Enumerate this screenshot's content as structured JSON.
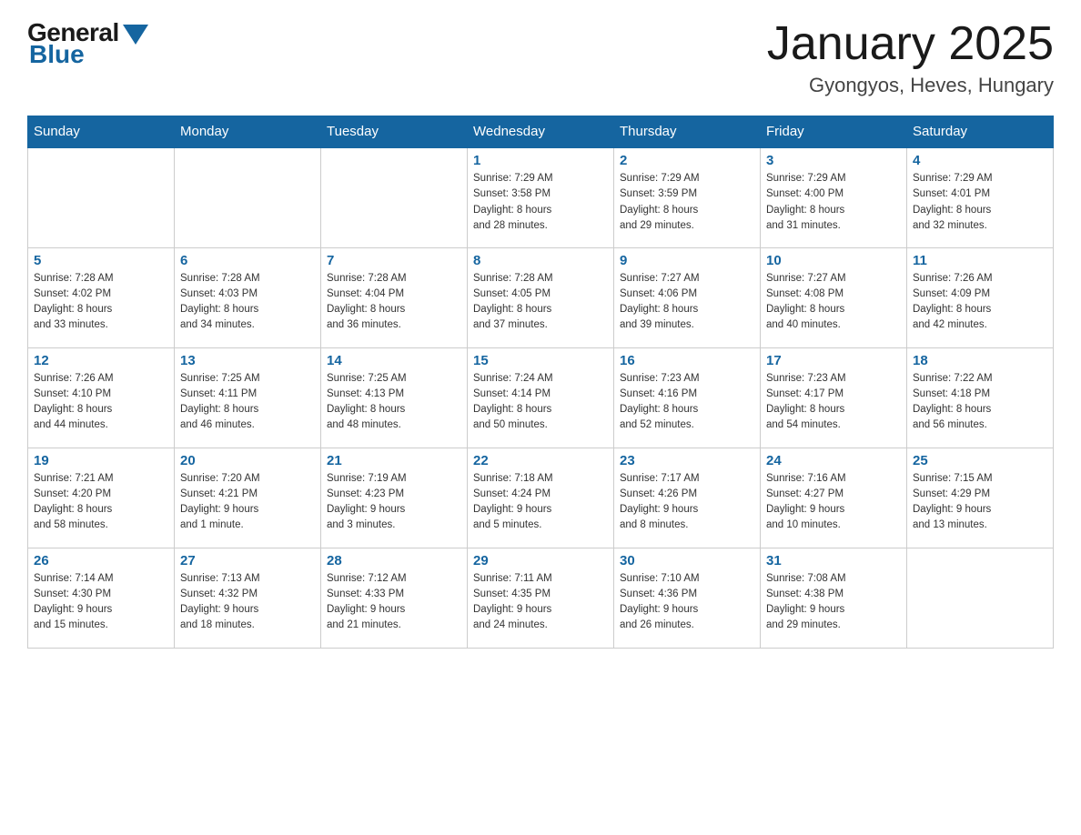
{
  "header": {
    "logo_general": "General",
    "logo_blue": "Blue",
    "title": "January 2025",
    "subtitle": "Gyongyos, Heves, Hungary"
  },
  "days_of_week": [
    "Sunday",
    "Monday",
    "Tuesday",
    "Wednesday",
    "Thursday",
    "Friday",
    "Saturday"
  ],
  "weeks": [
    [
      {
        "day": "",
        "info": ""
      },
      {
        "day": "",
        "info": ""
      },
      {
        "day": "",
        "info": ""
      },
      {
        "day": "1",
        "info": "Sunrise: 7:29 AM\nSunset: 3:58 PM\nDaylight: 8 hours\nand 28 minutes."
      },
      {
        "day": "2",
        "info": "Sunrise: 7:29 AM\nSunset: 3:59 PM\nDaylight: 8 hours\nand 29 minutes."
      },
      {
        "day": "3",
        "info": "Sunrise: 7:29 AM\nSunset: 4:00 PM\nDaylight: 8 hours\nand 31 minutes."
      },
      {
        "day": "4",
        "info": "Sunrise: 7:29 AM\nSunset: 4:01 PM\nDaylight: 8 hours\nand 32 minutes."
      }
    ],
    [
      {
        "day": "5",
        "info": "Sunrise: 7:28 AM\nSunset: 4:02 PM\nDaylight: 8 hours\nand 33 minutes."
      },
      {
        "day": "6",
        "info": "Sunrise: 7:28 AM\nSunset: 4:03 PM\nDaylight: 8 hours\nand 34 minutes."
      },
      {
        "day": "7",
        "info": "Sunrise: 7:28 AM\nSunset: 4:04 PM\nDaylight: 8 hours\nand 36 minutes."
      },
      {
        "day": "8",
        "info": "Sunrise: 7:28 AM\nSunset: 4:05 PM\nDaylight: 8 hours\nand 37 minutes."
      },
      {
        "day": "9",
        "info": "Sunrise: 7:27 AM\nSunset: 4:06 PM\nDaylight: 8 hours\nand 39 minutes."
      },
      {
        "day": "10",
        "info": "Sunrise: 7:27 AM\nSunset: 4:08 PM\nDaylight: 8 hours\nand 40 minutes."
      },
      {
        "day": "11",
        "info": "Sunrise: 7:26 AM\nSunset: 4:09 PM\nDaylight: 8 hours\nand 42 minutes."
      }
    ],
    [
      {
        "day": "12",
        "info": "Sunrise: 7:26 AM\nSunset: 4:10 PM\nDaylight: 8 hours\nand 44 minutes."
      },
      {
        "day": "13",
        "info": "Sunrise: 7:25 AM\nSunset: 4:11 PM\nDaylight: 8 hours\nand 46 minutes."
      },
      {
        "day": "14",
        "info": "Sunrise: 7:25 AM\nSunset: 4:13 PM\nDaylight: 8 hours\nand 48 minutes."
      },
      {
        "day": "15",
        "info": "Sunrise: 7:24 AM\nSunset: 4:14 PM\nDaylight: 8 hours\nand 50 minutes."
      },
      {
        "day": "16",
        "info": "Sunrise: 7:23 AM\nSunset: 4:16 PM\nDaylight: 8 hours\nand 52 minutes."
      },
      {
        "day": "17",
        "info": "Sunrise: 7:23 AM\nSunset: 4:17 PM\nDaylight: 8 hours\nand 54 minutes."
      },
      {
        "day": "18",
        "info": "Sunrise: 7:22 AM\nSunset: 4:18 PM\nDaylight: 8 hours\nand 56 minutes."
      }
    ],
    [
      {
        "day": "19",
        "info": "Sunrise: 7:21 AM\nSunset: 4:20 PM\nDaylight: 8 hours\nand 58 minutes."
      },
      {
        "day": "20",
        "info": "Sunrise: 7:20 AM\nSunset: 4:21 PM\nDaylight: 9 hours\nand 1 minute."
      },
      {
        "day": "21",
        "info": "Sunrise: 7:19 AM\nSunset: 4:23 PM\nDaylight: 9 hours\nand 3 minutes."
      },
      {
        "day": "22",
        "info": "Sunrise: 7:18 AM\nSunset: 4:24 PM\nDaylight: 9 hours\nand 5 minutes."
      },
      {
        "day": "23",
        "info": "Sunrise: 7:17 AM\nSunset: 4:26 PM\nDaylight: 9 hours\nand 8 minutes."
      },
      {
        "day": "24",
        "info": "Sunrise: 7:16 AM\nSunset: 4:27 PM\nDaylight: 9 hours\nand 10 minutes."
      },
      {
        "day": "25",
        "info": "Sunrise: 7:15 AM\nSunset: 4:29 PM\nDaylight: 9 hours\nand 13 minutes."
      }
    ],
    [
      {
        "day": "26",
        "info": "Sunrise: 7:14 AM\nSunset: 4:30 PM\nDaylight: 9 hours\nand 15 minutes."
      },
      {
        "day": "27",
        "info": "Sunrise: 7:13 AM\nSunset: 4:32 PM\nDaylight: 9 hours\nand 18 minutes."
      },
      {
        "day": "28",
        "info": "Sunrise: 7:12 AM\nSunset: 4:33 PM\nDaylight: 9 hours\nand 21 minutes."
      },
      {
        "day": "29",
        "info": "Sunrise: 7:11 AM\nSunset: 4:35 PM\nDaylight: 9 hours\nand 24 minutes."
      },
      {
        "day": "30",
        "info": "Sunrise: 7:10 AM\nSunset: 4:36 PM\nDaylight: 9 hours\nand 26 minutes."
      },
      {
        "day": "31",
        "info": "Sunrise: 7:08 AM\nSunset: 4:38 PM\nDaylight: 9 hours\nand 29 minutes."
      },
      {
        "day": "",
        "info": ""
      }
    ]
  ]
}
